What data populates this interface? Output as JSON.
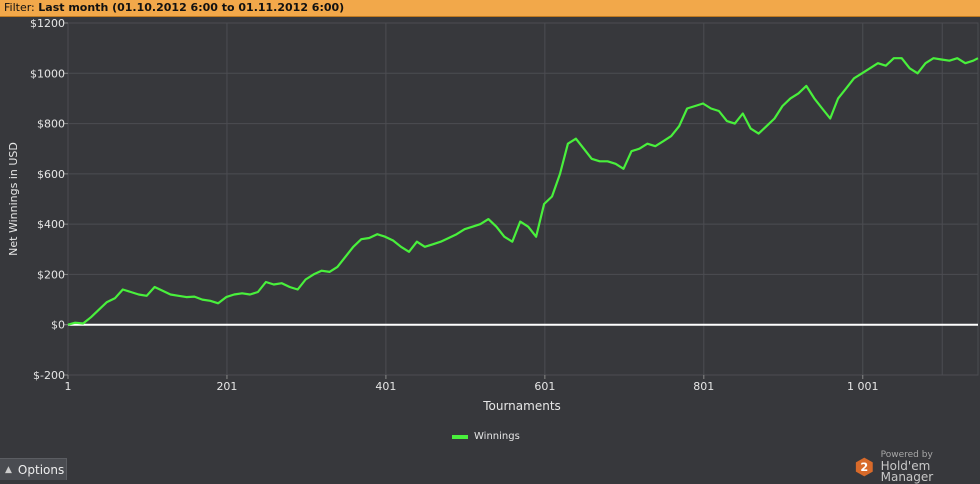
{
  "filter": {
    "label": "Filter:",
    "value": "Last month (01.10.2012 6:00 to 01.11.2012 6:00)"
  },
  "options_button": {
    "label": "Options",
    "icon": "caret-up-icon"
  },
  "branding": {
    "powered_by": "Powered by",
    "product": "Hold'em Manager",
    "logo_glyph": "2"
  },
  "colors": {
    "series": "#49f03c",
    "zero_line": "#ffffff",
    "background": "#37383c",
    "filter_bar": "#f2a84a"
  },
  "chart_data": {
    "type": "line",
    "title": "",
    "xlabel": "Tournaments",
    "ylabel": "Net Winnings in USD",
    "xlim": [
      1,
      1146
    ],
    "ylim": [
      -200,
      1200
    ],
    "x_ticks": [
      1,
      201,
      401,
      601,
      801,
      1001
    ],
    "x_tick_labels": [
      "1",
      "201",
      "401",
      "601",
      "801",
      "1 001"
    ],
    "y_ticks": [
      -200,
      0,
      200,
      400,
      600,
      800,
      1000,
      1200
    ],
    "y_tick_labels": [
      "$-200",
      "$0",
      "$200",
      "$400",
      "$600",
      "$800",
      "$1000",
      "$1200"
    ],
    "grid": true,
    "legend_position": "bottom-center",
    "reference_line": 0,
    "series": [
      {
        "name": "Winnings",
        "x": [
          1,
          10,
          20,
          30,
          40,
          50,
          60,
          70,
          80,
          90,
          100,
          110,
          120,
          130,
          140,
          150,
          160,
          170,
          180,
          190,
          200,
          210,
          220,
          230,
          240,
          250,
          260,
          270,
          280,
          290,
          300,
          310,
          320,
          330,
          340,
          350,
          360,
          370,
          380,
          390,
          400,
          410,
          420,
          430,
          440,
          450,
          460,
          470,
          480,
          490,
          500,
          510,
          520,
          530,
          540,
          550,
          560,
          570,
          580,
          590,
          600,
          610,
          620,
          630,
          640,
          650,
          660,
          670,
          680,
          690,
          700,
          710,
          720,
          730,
          740,
          750,
          760,
          770,
          780,
          790,
          800,
          810,
          820,
          830,
          840,
          850,
          860,
          870,
          880,
          890,
          900,
          910,
          920,
          930,
          940,
          950,
          960,
          970,
          980,
          990,
          1000,
          1010,
          1020,
          1030,
          1040,
          1050,
          1060,
          1070,
          1080,
          1090,
          1100,
          1110,
          1120,
          1130,
          1140,
          1146
        ],
        "y": [
          0,
          8,
          5,
          30,
          60,
          90,
          105,
          140,
          130,
          120,
          115,
          150,
          135,
          120,
          115,
          110,
          112,
          100,
          95,
          85,
          110,
          120,
          125,
          120,
          130,
          170,
          160,
          165,
          150,
          140,
          180,
          200,
          215,
          210,
          230,
          270,
          310,
          340,
          345,
          360,
          350,
          335,
          310,
          290,
          330,
          310,
          320,
          330,
          345,
          360,
          380,
          390,
          400,
          420,
          390,
          350,
          330,
          410,
          390,
          350,
          480,
          510,
          600,
          720,
          740,
          700,
          660,
          650,
          650,
          640,
          620,
          690,
          700,
          720,
          710,
          730,
          750,
          790,
          860,
          870,
          880,
          860,
          850,
          810,
          800,
          840,
          780,
          760,
          790,
          820,
          870,
          900,
          920,
          950,
          900,
          860,
          820,
          900,
          940,
          980,
          1000,
          1020,
          1040,
          1030,
          1060,
          1060,
          1020,
          1000,
          1040,
          1060,
          1055,
          1050,
          1060,
          1040,
          1050,
          1060
        ]
      }
    ]
  }
}
